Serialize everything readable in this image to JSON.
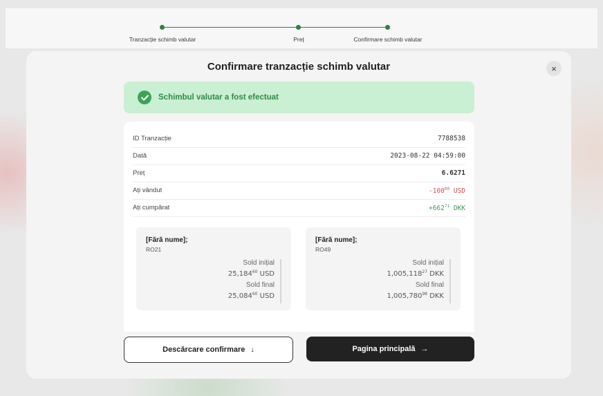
{
  "stepper": {
    "steps": [
      {
        "label": "Tranzacție schimb valutar"
      },
      {
        "label": "Preț"
      },
      {
        "label": "Confirmare schimb valutar"
      }
    ],
    "active_color": "#2f7f3f"
  },
  "modal": {
    "title": "Confirmare tranzacție schimb valutar",
    "close_icon": "×"
  },
  "success": {
    "message": "Schimbul valutar a fost efectuat",
    "icon": "check-circle-icon",
    "color": "#3ea357"
  },
  "details": [
    {
      "label": "ID Tranzacție",
      "value": "7788538"
    },
    {
      "label": "Dată",
      "value": "2023-08-22 04:59:00"
    },
    {
      "label": "Preț",
      "value": "6.6271"
    },
    {
      "label": "Ați vândut",
      "value_main": "-100",
      "value_dec": "00",
      "value_cur": " USD"
    },
    {
      "label": "Ați cumpărat",
      "value_main": "+662",
      "value_dec": "71",
      "value_cur": " DKK"
    }
  ],
  "accounts": [
    {
      "name": "[Fără nume];",
      "iban": "RO21",
      "initial_label": "Sold inițial",
      "initial_main": "25,184",
      "initial_dec": "60",
      "initial_cur": " USD",
      "final_label": "Sold final",
      "final_main": "25,084",
      "final_dec": "60",
      "final_cur": " USD"
    },
    {
      "name": "[Fără nume];",
      "iban": "RO49",
      "initial_label": "Sold inițial",
      "initial_main": "1,005,118",
      "initial_dec": "27",
      "initial_cur": " DKK",
      "final_label": "Sold final",
      "final_main": "1,005,780",
      "final_dec": "98",
      "final_cur": " DKK"
    }
  ],
  "buttons": {
    "download_label": "Descărcare confirmare",
    "download_icon": "↓",
    "home_label": "Pagina principală",
    "home_icon": "→"
  }
}
